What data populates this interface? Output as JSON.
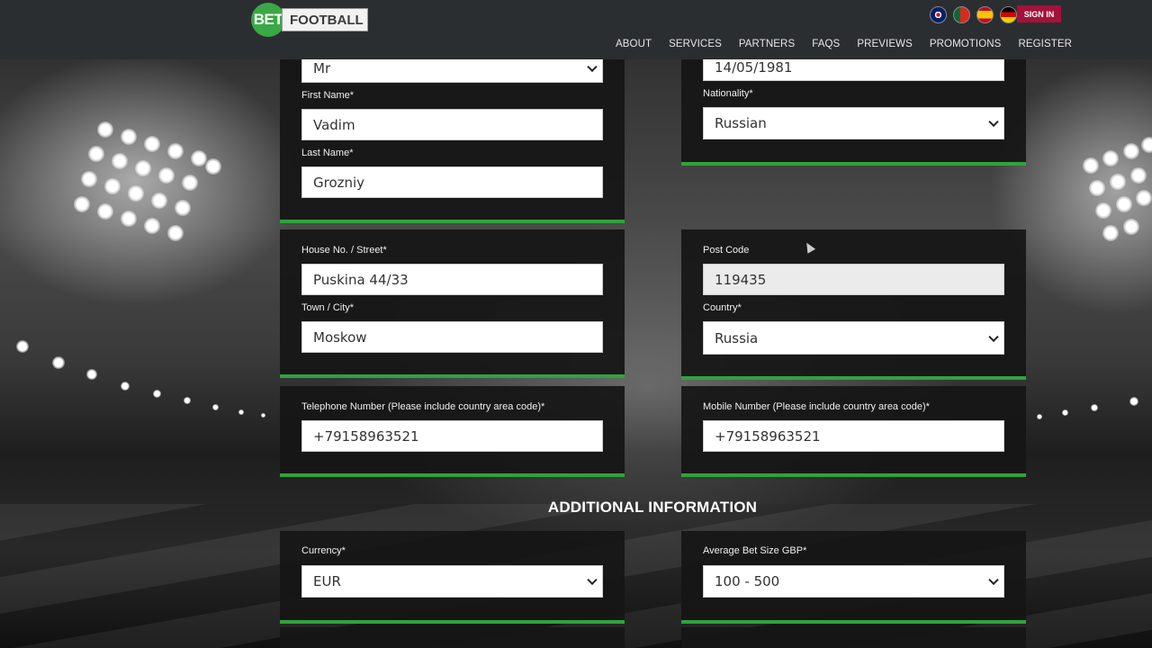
{
  "logo": {
    "bet": "BET",
    "football": "FOOTBALL"
  },
  "header": {
    "flags": [
      "uk-flag-icon",
      "portugal-flag-icon",
      "spain-flag-icon",
      "germany-flag-icon"
    ],
    "signin_label": "SIGN IN",
    "nav": [
      "ABOUT",
      "SERVICES",
      "PARTNERS",
      "FAQS",
      "PREVIEWS",
      "PROMOTIONS",
      "REGISTER"
    ]
  },
  "form": {
    "title_value": "Mr",
    "first_name_label": "First Name*",
    "first_name_value": "Vadim",
    "last_name_label": "Last Name*",
    "last_name_value": "Grozniy",
    "dob_value": "14/05/1981",
    "nationality_label": "Nationality*",
    "nationality_value": "Russian",
    "street_label": "House No. / Street*",
    "street_value": "Puskina 44/33",
    "city_label": "Town / City*",
    "city_value": "Moskow",
    "postcode_label": "Post Code",
    "postcode_value": "119435",
    "country_label": "Country*",
    "country_value": "Russia",
    "telephone_label": "Telephone Number (Please include country area code)*",
    "telephone_value": "+79158963521",
    "mobile_label": "Mobile Number (Please include country area code)*",
    "mobile_value": "+79158963521"
  },
  "additional": {
    "title": "ADDITIONAL INFORMATION",
    "currency_label": "Currency*",
    "currency_value": "EUR",
    "bet_size_label": "Average Bet Size GBP*",
    "bet_size_value": "100 - 500"
  },
  "colors": {
    "accent_green": "#2fa33c",
    "signin_red": "#a3123a",
    "header_bg": "#2b2e31"
  }
}
